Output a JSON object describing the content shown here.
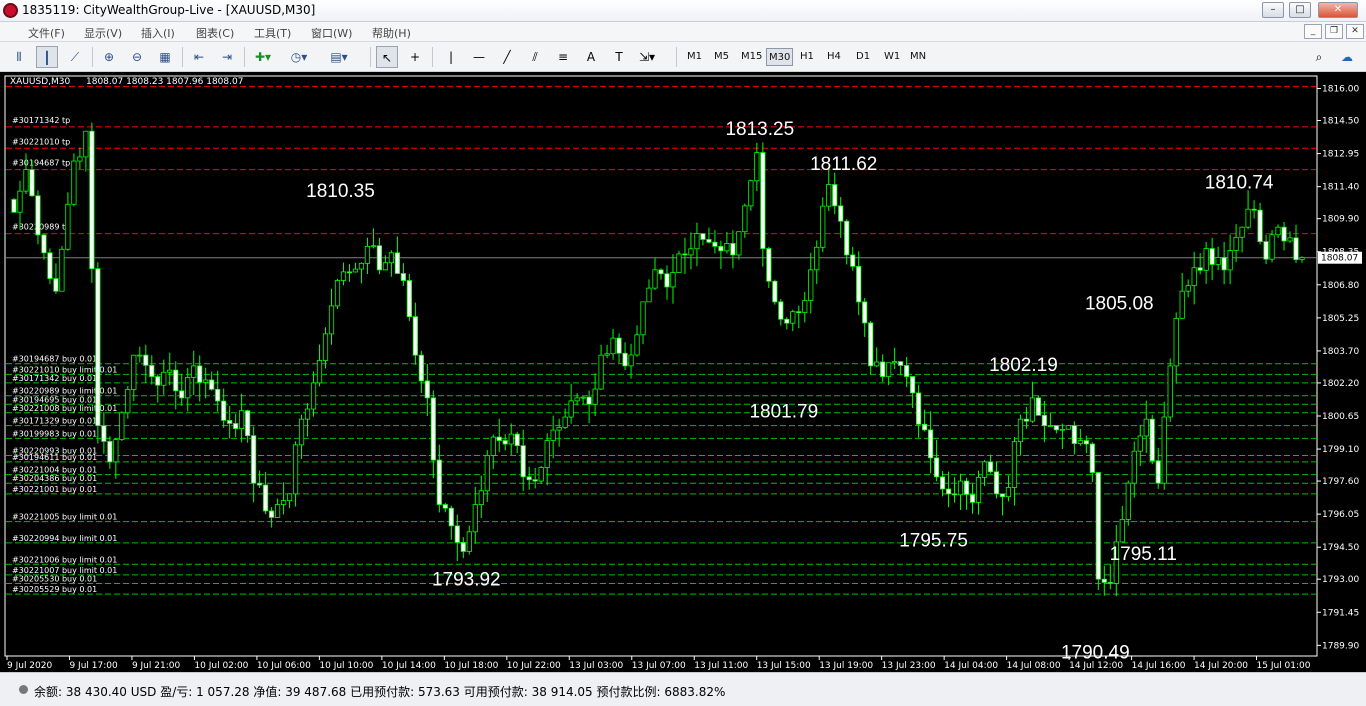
{
  "window": {
    "title": "1835119: CityWealthGroup-Live - [XAUUSD,M30]",
    "buttons": [
      "–",
      "□",
      "✕"
    ]
  },
  "menu": {
    "items": [
      "文件(F)",
      "显示(V)",
      "插入(I)",
      "图表(C)",
      "工具(T)",
      "窗口(W)",
      "帮助(H)"
    ],
    "mdi_buttons": [
      "_",
      "❐",
      "✕"
    ]
  },
  "toolbar": {
    "timeframes": [
      "M1",
      "M5",
      "M15",
      "M30",
      "H1",
      "H4",
      "D1",
      "W1",
      "MN"
    ],
    "active_timeframe": "M30",
    "icons": [
      "new-order-icon",
      "profiles-icon",
      "navigator-icon",
      "zoom-in-icon",
      "zoom-out-icon",
      "tile-icon",
      "autoscroll-icon",
      "shift-icon",
      "indicators-icon",
      "periods-icon",
      "templates-icon",
      "cursor-icon",
      "crosshair-icon",
      "vertical-line-icon",
      "horizontal-line-icon",
      "trendline-icon",
      "channel-icon",
      "fibonacci-icon",
      "text-icon",
      "label-icon",
      "arrows-icon",
      "search-icon",
      "community-icon"
    ]
  },
  "chart": {
    "symbol_info": "XAUUSD,M30",
    "ohlc": "1808.07 1808.23 1807.96 1808.07",
    "current_price": "1808.07",
    "colors": {
      "background": "#000000",
      "bull_body": "#000000",
      "bull_border": "#00ff00",
      "bear_body": "#ffffff",
      "bear_border": "#00ff00",
      "axis": "#ffffff",
      "sell_levels": "#ff0000",
      "buy_levels": "#00c000",
      "bid_line": "#808080",
      "annotation": "#ffffff"
    }
  },
  "chart_data": {
    "type": "candlestick",
    "title": "XAUUSD,M30",
    "y_ticks": [
      "1816.00",
      "1814.50",
      "1812.95",
      "1811.40",
      "1809.90",
      "1808.35",
      "1806.80",
      "1805.25",
      "1803.70",
      "1802.20",
      "1800.65",
      "1799.10",
      "1797.60",
      "1796.05",
      "1794.50",
      "1793.00",
      "1791.45",
      "1789.90"
    ],
    "x_labels": [
      "9 Jul 2020",
      "9 Jul 17:00",
      "9 Jul 21:00",
      "10 Jul 02:00",
      "10 Jul 06:00",
      "10 Jul 10:00",
      "10 Jul 14:00",
      "10 Jul 18:00",
      "10 Jul 22:00",
      "13 Jul 03:00",
      "13 Jul 07:00",
      "13 Jul 11:00",
      "13 Jul 15:00",
      "13 Jul 19:00",
      "13 Jul 23:00",
      "14 Jul 04:00",
      "14 Jul 08:00",
      "14 Jul 12:00",
      "14 Jul 16:00",
      "14 Jul 20:00",
      "15 Jul 01:00"
    ],
    "ylim": [
      1789.9,
      1816.5
    ],
    "candle_count": 216,
    "waypoints": [
      [
        0,
        1810.2
      ],
      [
        2,
        1812.2
      ],
      [
        5,
        1808.3
      ],
      [
        7,
        1806.5
      ],
      [
        10,
        1812.6
      ],
      [
        12,
        1814.0
      ],
      [
        14,
        1800.2
      ],
      [
        16,
        1798.5
      ],
      [
        18,
        1800.8
      ],
      [
        20,
        1803.5
      ],
      [
        23,
        1802.5
      ],
      [
        26,
        1802.8
      ],
      [
        28,
        1801.5
      ],
      [
        30,
        1803.0
      ],
      [
        33,
        1801.9
      ],
      [
        36,
        1800.3
      ],
      [
        38,
        1800.9
      ],
      [
        40,
        1797.5
      ],
      [
        42,
        1796.2
      ],
      [
        44,
        1796.5
      ],
      [
        46,
        1797.0
      ],
      [
        48,
        1800.5
      ],
      [
        50,
        1802.2
      ],
      [
        52,
        1804.5
      ],
      [
        54,
        1807.0
      ],
      [
        56,
        1807.4
      ],
      [
        59,
        1808.6
      ],
      [
        61,
        1807.5
      ],
      [
        63,
        1808.3
      ],
      [
        65,
        1807.0
      ],
      [
        67,
        1803.5
      ],
      [
        69,
        1801.5
      ],
      [
        71,
        1796.5
      ],
      [
        73,
        1795.5
      ],
      [
        75,
        1794.3
      ],
      [
        77,
        1796.5
      ],
      [
        79,
        1798.8
      ],
      [
        81,
        1799.5
      ],
      [
        83,
        1799.8
      ],
      [
        85,
        1797.8
      ],
      [
        87,
        1797.6
      ],
      [
        89,
        1799.5
      ],
      [
        92,
        1800.6
      ],
      [
        94,
        1801.5
      ],
      [
        96,
        1801.2
      ],
      [
        98,
        1803.5
      ],
      [
        100,
        1804.3
      ],
      [
        102,
        1803.0
      ],
      [
        105,
        1806.0
      ],
      [
        107,
        1807.5
      ],
      [
        109,
        1806.7
      ],
      [
        112,
        1808.2
      ],
      [
        114,
        1809.2
      ],
      [
        117,
        1808.6
      ],
      [
        120,
        1808.2
      ],
      [
        122,
        1810.5
      ],
      [
        124,
        1813.0
      ],
      [
        125,
        1808.5
      ],
      [
        127,
        1806.0
      ],
      [
        129,
        1805.0
      ],
      [
        131,
        1805.5
      ],
      [
        133,
        1807.5
      ],
      [
        136,
        1811.5
      ],
      [
        137,
        1810.5
      ],
      [
        139,
        1808.2
      ],
      [
        141,
        1806.0
      ],
      [
        143,
        1803.0
      ],
      [
        145,
        1802.5
      ],
      [
        147,
        1803.2
      ],
      [
        149,
        1802.5
      ],
      [
        152,
        1800.0
      ],
      [
        154,
        1797.8
      ],
      [
        156,
        1797.0
      ],
      [
        158,
        1797.6
      ],
      [
        160,
        1796.6
      ],
      [
        162,
        1798.5
      ],
      [
        164,
        1797.0
      ],
      [
        166,
        1797.3
      ],
      [
        168,
        1800.5
      ],
      [
        170,
        1801.5
      ],
      [
        172,
        1800.2
      ],
      [
        174,
        1800.0
      ],
      [
        176,
        1800.2
      ],
      [
        178,
        1799.5
      ],
      [
        180,
        1798.0
      ],
      [
        181,
        1793.0
      ],
      [
        183,
        1792.8
      ],
      [
        185,
        1795.8
      ],
      [
        187,
        1799.0
      ],
      [
        189,
        1800.5
      ],
      [
        191,
        1797.5
      ],
      [
        193,
        1803.0
      ],
      [
        195,
        1806.5
      ],
      [
        197,
        1807.6
      ],
      [
        199,
        1808.5
      ],
      [
        202,
        1807.5
      ],
      [
        205,
        1809.5
      ],
      [
        207,
        1810.3
      ],
      [
        209,
        1808.0
      ],
      [
        211,
        1809.5
      ],
      [
        213,
        1809.0
      ],
      [
        215,
        1808.07
      ]
    ],
    "price_labels": [
      {
        "text": "1810.35",
        "price": 1810.35,
        "candle": 55
      },
      {
        "text": "1813.25",
        "price": 1813.25,
        "candle": 125
      },
      {
        "text": "1811.62",
        "price": 1811.62,
        "candle": 139
      },
      {
        "text": "1801.79",
        "price": 1801.79,
        "candle": 129
      },
      {
        "text": "1793.92",
        "price": 1793.92,
        "candle": 76
      },
      {
        "text": "1795.75",
        "price": 1795.75,
        "candle": 154
      },
      {
        "text": "1802.19",
        "price": 1802.19,
        "candle": 169
      },
      {
        "text": "1805.08",
        "price": 1805.08,
        "candle": 185
      },
      {
        "text": "1795.11",
        "price": 1795.11,
        "candle": 189
      },
      {
        "text": "1790.49",
        "price": 1790.49,
        "candle": 181
      },
      {
        "text": "1810.74",
        "price": 1810.74,
        "candle": 205
      }
    ],
    "sell_levels": [
      {
        "label": "",
        "price": 1816.1
      },
      {
        "label": "#30171342 tp",
        "price": 1814.2
      },
      {
        "label": "#30221010 tp",
        "price": 1813.2
      },
      {
        "label": "#30194687 tp",
        "price": 1812.2
      },
      {
        "label": "#30220989 tp",
        "price": 1809.2
      }
    ],
    "buy_levels": [
      {
        "label": "#30194687 buy 0.01",
        "price": 1803.1
      },
      {
        "label": "#30221010 buy limit 0.01",
        "price": 1802.6
      },
      {
        "label": "#30171342 buy 0.01",
        "price": 1802.2
      },
      {
        "label": "#30220989 buy limit 0.01",
        "price": 1801.6
      },
      {
        "label": "#30194695 buy 0.01",
        "price": 1801.2
      },
      {
        "label": "#30221008 buy limit 0.01",
        "price": 1800.8
      },
      {
        "label": "#30171329 buy 0.01",
        "price": 1800.2
      },
      {
        "label": "#30199983 buy 0.01",
        "price": 1799.6
      },
      {
        "label": "#30220993 buy 0.01",
        "price": 1798.8
      },
      {
        "label": "#30194611 buy 0.01",
        "price": 1798.5
      },
      {
        "label": "#30221004 buy 0.01",
        "price": 1797.9
      },
      {
        "label": "#30204386 buy 0.01",
        "price": 1797.5
      },
      {
        "label": "#30221001 buy 0.01",
        "price": 1797.0
      },
      {
        "label": "#30221005 buy limit 0.01",
        "price": 1795.7
      },
      {
        "label": "#30220994 buy limit 0.01",
        "price": 1794.7
      },
      {
        "label": "#30221006 buy limit 0.01",
        "price": 1793.7
      },
      {
        "label": "#30221007 buy limit 0.01",
        "price": 1793.2
      },
      {
        "label": "#30205530 buy 0.01",
        "price": 1792.8
      },
      {
        "label": "#30205529 buy 0.01",
        "price": 1792.3
      }
    ]
  },
  "status": {
    "text": "余额: 38 430.40 USD   盈/亏: 1 057.28   净值: 39 487.68   已用预付款: 573.63   可用预付款: 38 914.05   预付款比例: 6883.82%"
  }
}
